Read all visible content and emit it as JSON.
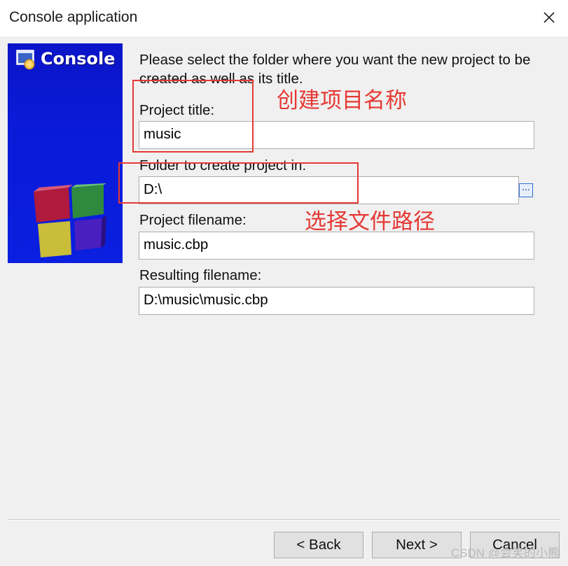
{
  "window": {
    "title": "Console application"
  },
  "banner": {
    "title": "Console"
  },
  "instructions": "Please select the folder where you want the new project to be created as well as its title.",
  "fields": {
    "project_title": {
      "label": "Project title:",
      "value": "music"
    },
    "folder": {
      "label": "Folder to create project in:",
      "value": "D:\\",
      "browse_label": "..."
    },
    "project_filename": {
      "label": "Project filename:",
      "value": "music.cbp"
    },
    "resulting_filename": {
      "label": "Resulting filename:",
      "value": "D:\\music\\music.cbp"
    }
  },
  "annotations": {
    "project_name_note": "创建项目名称",
    "file_path_note": "选择文件路径"
  },
  "buttons": {
    "back": "< Back",
    "next": "Next >",
    "cancel": "Cancel"
  },
  "watermark": "CSDN @会笑的小熊",
  "colors": {
    "banner_blue": "#0a1bd8",
    "annotation_red": "#e53935",
    "window_bg": "#f0f0f0"
  },
  "icons": {
    "close": "close-icon",
    "banner": "console-app-icon",
    "logo": "codeblocks-cube-logo"
  }
}
